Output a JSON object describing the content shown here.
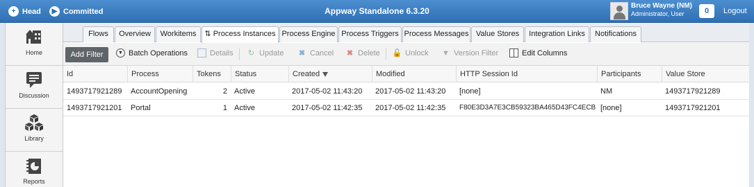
{
  "topbar": {
    "head_label": "Head",
    "committed_label": "Committed",
    "title": "Appway Standalone 6.3.20",
    "user_name": "Bruce Wayne (NM)",
    "user_role": "Administrator, User",
    "notification_count": "0",
    "logout_label": "Logout"
  },
  "sidebar": {
    "items": [
      {
        "label": "Home",
        "icon": "home-icon"
      },
      {
        "label": "Discussion",
        "icon": "discussion-icon"
      },
      {
        "label": "Library",
        "icon": "library-icon"
      },
      {
        "label": "Reports",
        "icon": "reports-icon"
      }
    ]
  },
  "tabs": [
    {
      "label": "Flows"
    },
    {
      "label": "Overview"
    },
    {
      "label": "Workitems"
    },
    {
      "label": "Process Instances",
      "active": true
    },
    {
      "label": "Process Engine"
    },
    {
      "label": "Process Triggers"
    },
    {
      "label": "Process Messages"
    },
    {
      "label": "Value Stores"
    },
    {
      "label": "Integration Links"
    },
    {
      "label": "Notifications"
    }
  ],
  "toolbar": {
    "add_filter": "Add Filter",
    "batch_operations": "Batch Operations",
    "details": "Details",
    "update": "Update",
    "cancel": "Cancel",
    "delete": "Delete",
    "unlock": "Unlock",
    "version_filter": "Version Filter",
    "edit_columns": "Edit Columns"
  },
  "table": {
    "columns": [
      "Id",
      "Process",
      "Tokens",
      "Status",
      "Created",
      "Modified",
      "HTTP Session Id",
      "Participants",
      "Value Store"
    ],
    "rows": [
      [
        "1493717921289",
        "AccountOpening",
        "2",
        "Active",
        "2017-05-02 11:43:20",
        "2017-05-02 11:43:20",
        "[none]",
        "NM",
        "1493717921289"
      ],
      [
        "1493717921201",
        "Portal",
        "1",
        "Active",
        "2017-05-02 11:42:35",
        "2017-05-02 11:42:35",
        "F80E3D3A7E3CB59323BA465D43FC4ECB",
        "[none]",
        "1493717921201"
      ]
    ]
  }
}
